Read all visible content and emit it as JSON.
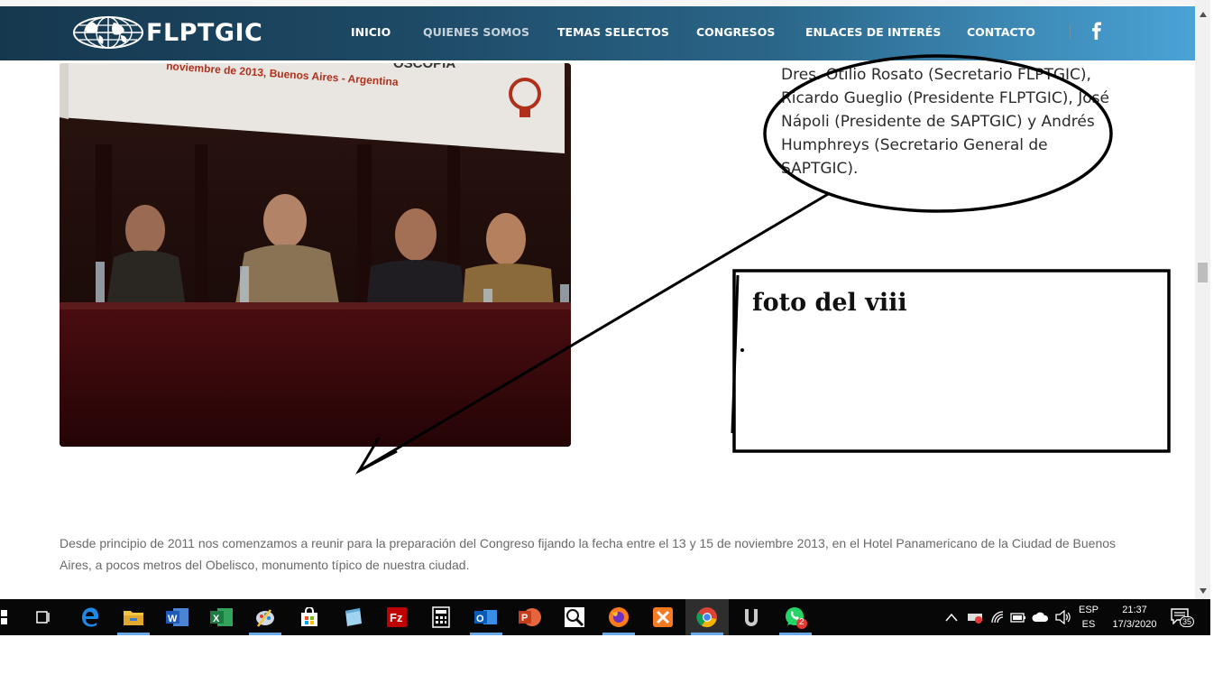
{
  "header": {
    "logo_text": "FLPTGIC",
    "nav": [
      {
        "label": "INICIO",
        "dim": false
      },
      {
        "label": "QUIENES SOMOS",
        "dim": true
      },
      {
        "label": "TEMAS SELECTOS",
        "dim": false
      },
      {
        "label": "CONGRESOS",
        "dim": false
      },
      {
        "label": "ENLACES DE INTERÉS",
        "dim": false
      },
      {
        "label": "CONTACTO",
        "dim": false
      }
    ],
    "social_icon": "facebook-icon"
  },
  "photo": {
    "banner_line1": "noviembre de 2013, Buenos Aires - Argentina",
    "banner_line2": "OSCOPIA"
  },
  "caption": {
    "text": "Dres. Otilio Rosato (Secretario FLPTGIC), Ricardo Gueglio (Presidente FLPTGIC), José Nápoli (Presidente de SAPTGIC) y Andrés Humphreys (Secretario General de SAPTGIC)."
  },
  "annotation": {
    "note": "foto del viii"
  },
  "paragraph": {
    "text": "Desde principio de 2011 nos comenzamos a reunir para la preparación del Congreso fijando la fecha entre el 13 y 15 de noviembre 2013, en el Hotel Panamericano de la Ciudad de Buenos Aires, a pocos metros del Obelisco, monumento típico de nuestra ciudad."
  },
  "taskbar": {
    "apps": [
      "start",
      "task-view",
      "edge",
      "file-explorer",
      "word",
      "excel",
      "paint",
      "store",
      "notepad",
      "filezilla",
      "calculator",
      "outlook",
      "powerpoint",
      "search-app",
      "firefox",
      "xampp",
      "chrome",
      "app-u",
      "whatsapp"
    ],
    "whatsapp_badge": "2",
    "language_top": "ESP",
    "language_bottom": "ES",
    "time": "21:37",
    "date": "17/3/2020",
    "notifications": "35"
  }
}
